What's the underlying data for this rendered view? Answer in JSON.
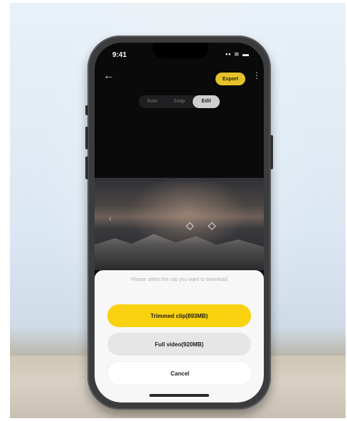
{
  "status_bar": {
    "time": "9:41",
    "icons": "▪▪ ≋ ▬"
  },
  "header": {
    "back_icon": "←",
    "export_label": "Export",
    "more_icon": "⋮"
  },
  "modes": [
    {
      "label": "Auto",
      "active": false
    },
    {
      "label": "Snap",
      "active": false
    },
    {
      "label": "Edit",
      "active": true
    }
  ],
  "video": {
    "prev_icon": "‹"
  },
  "download_sheet": {
    "prompt": "Please select the clip you want to download",
    "trimmed_label": "Trimmed clip(893MB)",
    "full_label": "Full video(920MB)",
    "cancel_label": "Cancel"
  },
  "colors": {
    "accent": "#f9d10f",
    "export": "#e6c22a"
  }
}
